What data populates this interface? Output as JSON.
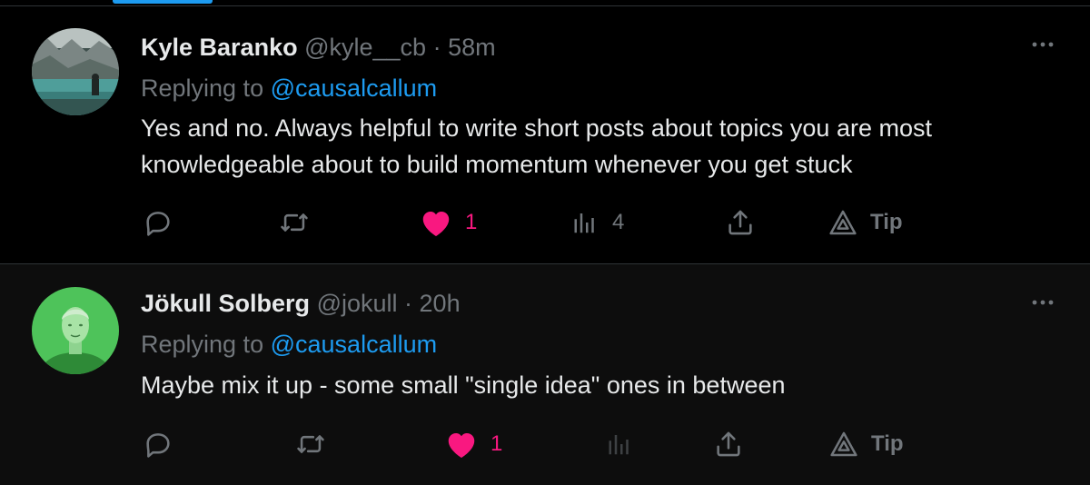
{
  "replies": [
    {
      "display_name": "Kyle Baranko",
      "handle": "@kyle__cb",
      "separator": "·",
      "timestamp": "58m",
      "replying_prefix": "Replying to",
      "replying_to": "@causalcallum",
      "text": "Yes and no. Always helpful to write short posts about topics you are most knowledgeable about to build momentum whenever you get stuck",
      "like_count": "1",
      "view_count": "4",
      "tip_label": "Tip",
      "avatar": "landscape-photo-avatar"
    },
    {
      "display_name": "Jökull Solberg",
      "handle": "@jokull",
      "separator": "·",
      "timestamp": "20h",
      "replying_prefix": "Replying to",
      "replying_to": "@causalcallum",
      "text": "Maybe mix it up - some small \"single idea\" ones in between",
      "like_count": "1",
      "view_count": "",
      "tip_label": "Tip",
      "avatar": "green-portrait-avatar"
    }
  ],
  "colors": {
    "background": "#000000",
    "text": "#e7e9ea",
    "muted": "#71767b",
    "accent": "#1d9bf0",
    "like": "#f91880",
    "divider": "#2f3336"
  }
}
